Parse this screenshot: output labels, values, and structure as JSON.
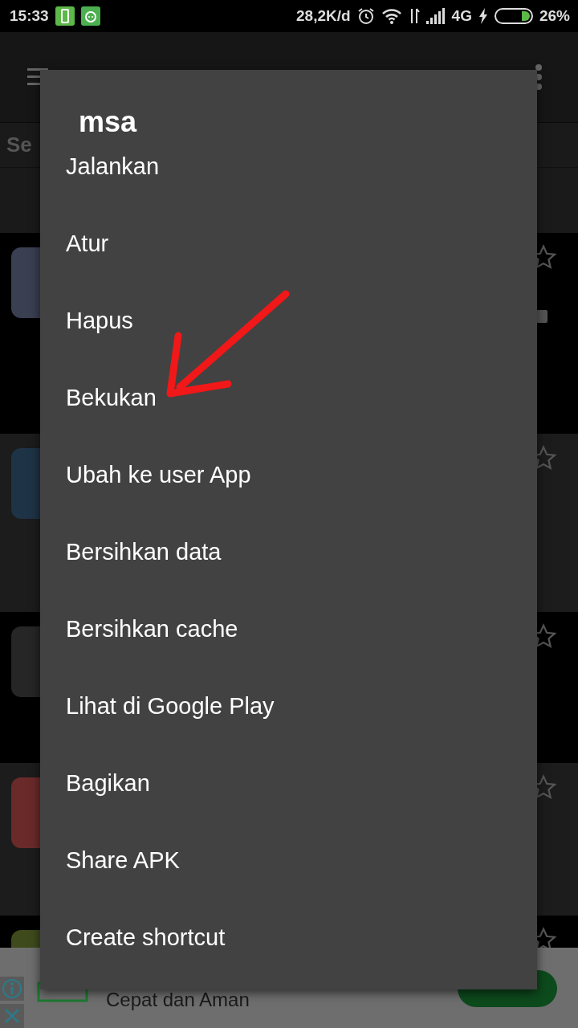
{
  "status_bar": {
    "time": "15:33",
    "data_rate": "28,2K/d",
    "network": "4G",
    "battery": "26%"
  },
  "list": {
    "section_label": "Se"
  },
  "dialog": {
    "title": "msa",
    "items": [
      "Jalankan",
      "Atur",
      "Hapus",
      "Bekukan",
      "Ubah ke user App",
      "Bersihkan data",
      "Bersihkan cache",
      "Lihat di Google Play",
      "Bagikan",
      "Share APK",
      "Create shortcut"
    ]
  },
  "ad": {
    "text": "Cepat dan Aman"
  }
}
